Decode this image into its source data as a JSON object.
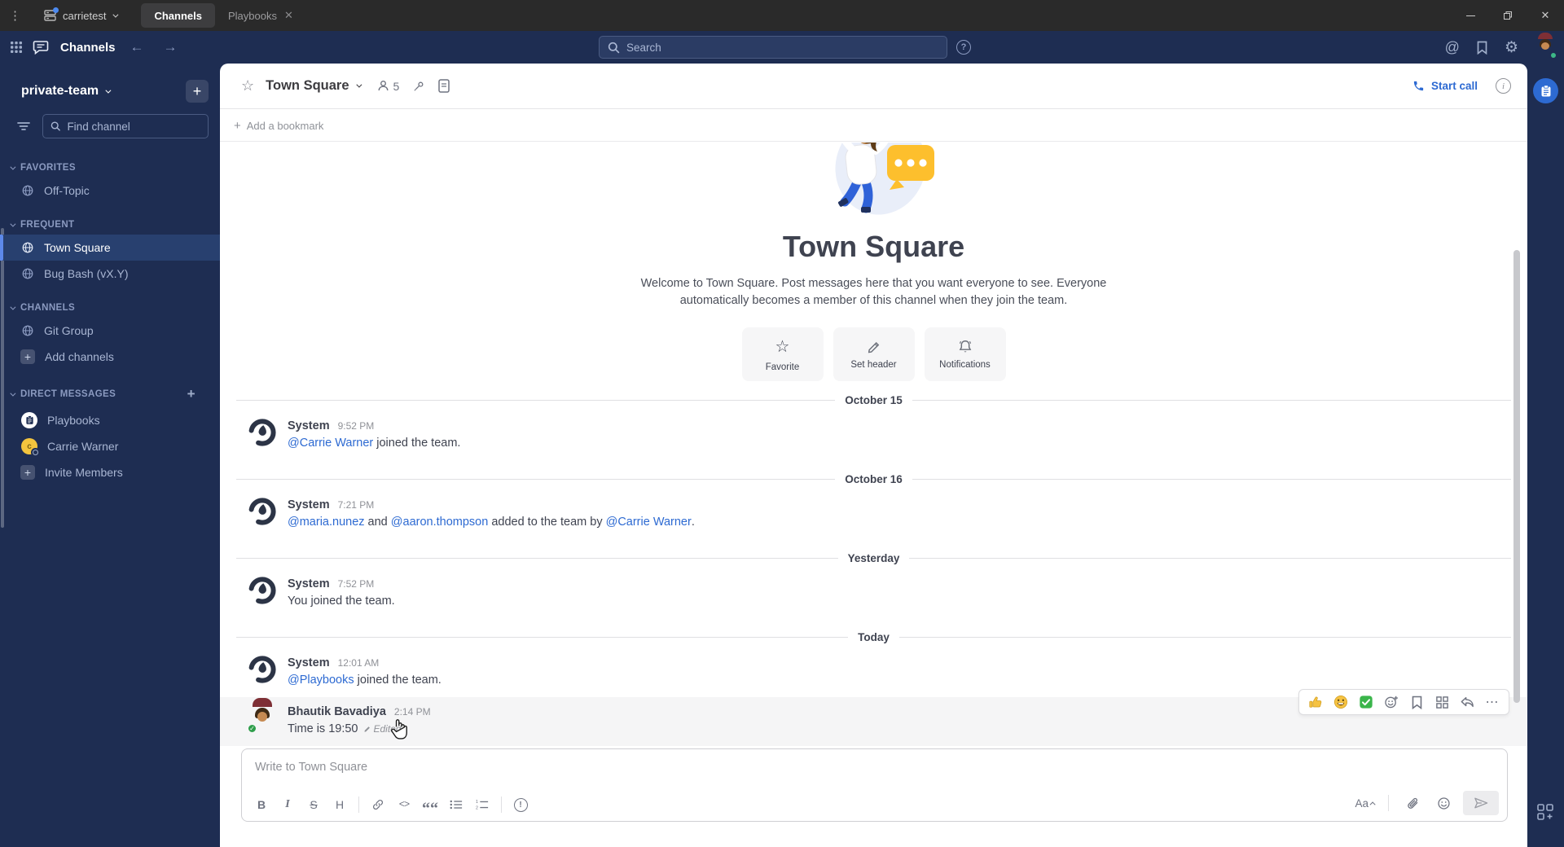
{
  "colors": {
    "titlebar_bg": "#2a2a2a",
    "chrome_navy": "#1e2d52",
    "accent_blue": "#1c58d9",
    "link_blue": "#2d6ad2",
    "selected_item_bg": "#28406f",
    "online_green": "#3db887",
    "hover_row_bg": "#f5f5f6",
    "reaction_yellow": "#f5c242",
    "reaction_green": "#3ab54a"
  },
  "window": {
    "server_name": "carrietest",
    "tabs": [
      {
        "label": "Channels",
        "active": true
      },
      {
        "label": "Playbooks",
        "active": false
      }
    ]
  },
  "global_header": {
    "product_name": "Channels",
    "search_placeholder": "Search"
  },
  "sidebar": {
    "team_name": "private-team",
    "find_placeholder": "Find channel",
    "sections": {
      "favorites": {
        "label": "FAVORITES",
        "items": [
          {
            "label": "Off-Topic"
          }
        ]
      },
      "frequent": {
        "label": "FREQUENT",
        "items": [
          {
            "label": "Town Square"
          },
          {
            "label": "Bug Bash (vX.Y)"
          }
        ]
      },
      "channels": {
        "label": "CHANNELS",
        "items": [
          {
            "label": "Git Group"
          },
          {
            "label": "Add channels"
          }
        ]
      },
      "direct_messages": {
        "label": "DIRECT MESSAGES",
        "items": [
          {
            "label": "Playbooks"
          },
          {
            "label": "Carrie Warner"
          },
          {
            "label": "Invite Members"
          }
        ]
      }
    }
  },
  "channel_header": {
    "name": "Town Square",
    "member_count": "5",
    "start_call_label": "Start call"
  },
  "bookmarks_bar": {
    "add_label": "Add a bookmark"
  },
  "intro": {
    "title": "Town Square",
    "description_line1": "Welcome to Town Square. Post messages here that you want everyone to see. Everyone",
    "description_line2": "automatically becomes a member of this channel when they join the team.",
    "actions": [
      {
        "label": "Favorite"
      },
      {
        "label": "Set header"
      },
      {
        "label": "Notifications"
      }
    ]
  },
  "timeline": {
    "dividers": [
      "October 15",
      "October 16",
      "Yesterday",
      "Today"
    ],
    "messages": [
      {
        "sender": "System",
        "time": "9:52 PM",
        "segments": [
          {
            "text": "@Carrie Warner"
          },
          {
            "text": " joined the team."
          }
        ]
      },
      {
        "sender": "System",
        "time": "7:21 PM",
        "segments": [
          {
            "text": "@maria.nunez"
          },
          {
            "text": " and "
          },
          {
            "text": "@aaron.thompson"
          },
          {
            "text": " added to the team by "
          },
          {
            "text": "@Carrie Warner"
          },
          {
            "text": "."
          }
        ]
      },
      {
        "sender": "System",
        "time": "7:52 PM",
        "segments": [
          {
            "text": "You joined the team."
          }
        ]
      },
      {
        "sender": "System",
        "time": "12:01 AM",
        "segments": [
          {
            "text": "@Playbooks"
          },
          {
            "text": " joined the team."
          }
        ]
      },
      {
        "sender": "Bhautik Bavadiya",
        "time": "2:14 PM",
        "segments": [
          {
            "text": "Time is 19:50"
          }
        ],
        "edited_label": "Edited"
      }
    ]
  },
  "composer": {
    "placeholder": "Write to Town Square",
    "toolbar": {
      "bold": "B",
      "italic": "I",
      "strikethrough": "S",
      "heading": "H",
      "code": "<>"
    },
    "format_toggle_label": "Aa"
  }
}
